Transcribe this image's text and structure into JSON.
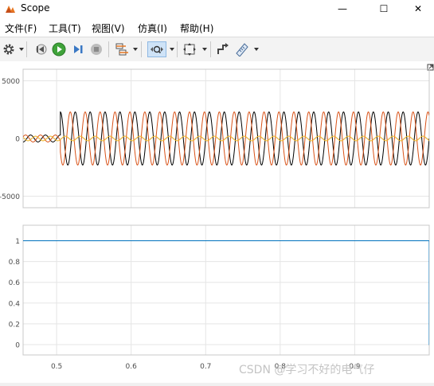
{
  "window": {
    "title": "Scope",
    "minimize_glyph": "—",
    "maximize_glyph": "☐",
    "close_glyph": "✕"
  },
  "menu": [
    {
      "label": "文件(F)"
    },
    {
      "label": "工具(T)"
    },
    {
      "label": "视图(V)"
    },
    {
      "label": "仿真(I)"
    },
    {
      "label": "帮助(H)"
    }
  ],
  "toolbar": {
    "icons": [
      "gear-icon",
      "step-back-icon",
      "run-icon",
      "step-forward-icon",
      "stop-icon",
      "signal-select-icon",
      "zoom-icon",
      "fit-to-view-icon",
      "triggers-icon",
      "measurements-icon"
    ]
  },
  "colors": {
    "series_black": "#000000",
    "series_red": "#d95319",
    "series_yellow": "#edb120",
    "series_blue": "#0072bd",
    "grid": "#e5e5e5",
    "axis_text": "#4d4d4d"
  },
  "chart_data": [
    {
      "type": "line",
      "title": "",
      "xlabel": "",
      "ylabel": "",
      "xlim": [
        0.455,
        1.0
      ],
      "ylim": [
        -6000,
        6000
      ],
      "yticks": [
        5000,
        0,
        -5000
      ],
      "ytick_labels": [
        "5000",
        "0",
        "-5000"
      ],
      "grid": true,
      "series": [
        {
          "color": "#000000",
          "segments": [
            {
              "x_start": 0.455,
              "x_end": 0.505,
              "amplitude": 300,
              "frequency": 50
            },
            {
              "x_start": 0.505,
              "x_end": 1.0,
              "amplitude": 2300,
              "frequency": 50
            }
          ]
        },
        {
          "color": "#d95319",
          "segments": [
            {
              "x_start": 0.455,
              "x_end": 0.505,
              "amplitude": 300,
              "frequency": 50
            },
            {
              "x_start": 0.505,
              "x_end": 1.0,
              "amplitude": 2300,
              "frequency": 50
            }
          ]
        },
        {
          "color": "#edb120",
          "segments": [
            {
              "x_start": 0.455,
              "x_end": 1.0,
              "amplitude": 200,
              "frequency": 50
            }
          ]
        }
      ]
    },
    {
      "type": "line",
      "title": "",
      "xlabel": "",
      "ylabel": "",
      "xlim": [
        0.455,
        1.0
      ],
      "ylim": [
        -0.1,
        1.15
      ],
      "yticks": [
        1,
        0.8,
        0.6,
        0.4,
        0.2,
        0
      ],
      "ytick_labels": [
        "1",
        "0.8",
        "0.6",
        "0.4",
        "0.2",
        "0"
      ],
      "xticks": [
        0.5,
        0.6,
        0.7,
        0.8,
        0.9
      ],
      "xtick_labels": [
        "0.5",
        "0.6",
        "0.7",
        "0.8",
        "0.9"
      ],
      "grid": true,
      "series": [
        {
          "color": "#0072bd",
          "x": [
            0.455,
            1.0,
            1.0,
            1.1
          ],
          "y": [
            1,
            1,
            0,
            0
          ]
        }
      ]
    }
  ],
  "watermark": "CSDN @学习不好的电气仔"
}
